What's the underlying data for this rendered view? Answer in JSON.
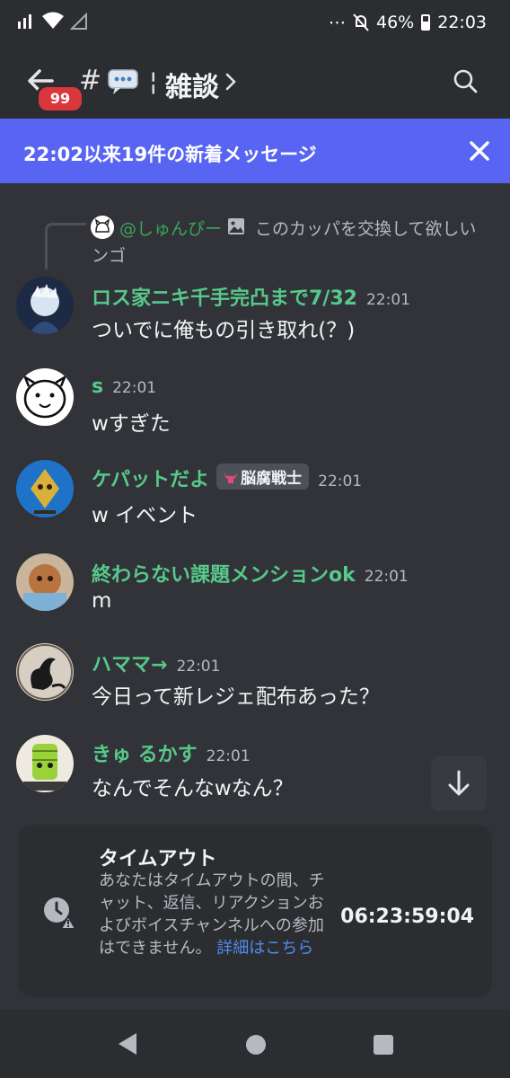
{
  "status_bar": {
    "battery": "46%",
    "clock": "22:03"
  },
  "header": {
    "unread_badge": "99",
    "hash_symbol": "#",
    "separator": "¦",
    "channel_name": "雑談"
  },
  "banner": {
    "text": "22:02以来19件の新着メッセージ"
  },
  "reply": {
    "author": "@しゅんぴー",
    "text_line1": "このカッパを交換して欲しい",
    "text_line2": "ンゴ"
  },
  "messages": [
    {
      "author": "ロス家ニキ千手完凸まで7/32",
      "time": "22:01",
      "text": "ついでに俺もの引き取れ(？)"
    },
    {
      "author": "s",
      "time": "22:01",
      "text": "wすぎた"
    },
    {
      "author": "ケパットだよ",
      "role": "脳腐戦士",
      "time": "22:01",
      "text": "w イベント"
    },
    {
      "author": "終わらない課題メンションok",
      "time": "22:01",
      "text": "m"
    },
    {
      "author": "ハママ→",
      "time": "22:01",
      "text": "今日って新レジェ配布あった？"
    },
    {
      "author": "きゅ るかす",
      "time": "22:01",
      "text": "なんでそんなwなん？"
    }
  ],
  "timeout": {
    "title": "タイムアウト",
    "body": "あなたはタイムアウトの間、チャット、返信、リアクションおよびボイスチャンネルへの参加はできません。",
    "link_text": "詳細はこちら",
    "remaining": "06:23:59:04"
  },
  "colors": {
    "background": "#313338",
    "banner": "#5865f2",
    "username_green": "#57c98a",
    "badge_red": "#da373c",
    "link_blue": "#4f8cf0"
  },
  "icons": [
    "signal-icon",
    "wifi-icon",
    "mute-icon",
    "battery-icon",
    "back-arrow-icon",
    "speech-bubble-icon",
    "chevron-right-icon",
    "search-icon",
    "close-icon",
    "image-icon",
    "arrow-down-icon",
    "clock-warning-icon",
    "nav-back-icon",
    "nav-home-icon",
    "nav-recent-icon"
  ]
}
